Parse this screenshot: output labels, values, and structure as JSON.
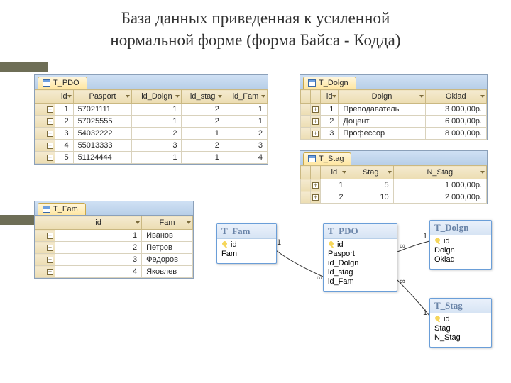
{
  "title_line1": "База данных приведенная к усиленной",
  "title_line2": "нормальной форме  (форма Байса - Кодда)",
  "tables": {
    "pdo": {
      "tab": "T_PDO",
      "cols": [
        "id",
        "Pasport",
        "id_Dolgn",
        "id_stag",
        "id_Fam"
      ],
      "rows": [
        [
          "1",
          "57021111",
          "1",
          "2",
          "1"
        ],
        [
          "2",
          "57025555",
          "1",
          "2",
          "1"
        ],
        [
          "3",
          "54032222",
          "2",
          "1",
          "2"
        ],
        [
          "4",
          "55013333",
          "3",
          "2",
          "3"
        ],
        [
          "5",
          "51124444",
          "1",
          "1",
          "4"
        ]
      ]
    },
    "dolgn": {
      "tab": "T_Dolgn",
      "cols": [
        "id",
        "Dolgn",
        "Oklad"
      ],
      "rows": [
        [
          "1",
          "Преподаватель",
          "3 000,00р."
        ],
        [
          "2",
          "Доцент",
          "6 000,00р."
        ],
        [
          "3",
          "Профессор",
          "8 000,00р."
        ]
      ]
    },
    "stag": {
      "tab": "T_Stag",
      "cols": [
        "id",
        "Stag",
        "N_Stag"
      ],
      "rows": [
        [
          "1",
          "5",
          "1 000,00р."
        ],
        [
          "2",
          "10",
          "2 000,00р."
        ]
      ]
    },
    "fam": {
      "tab": "T_Fam",
      "cols": [
        "id",
        "Fam"
      ],
      "rows": [
        [
          "1",
          "Иванов"
        ],
        [
          "2",
          "Петров"
        ],
        [
          "3",
          "Федоров"
        ],
        [
          "4",
          "Яковлев"
        ]
      ]
    }
  },
  "diagram": {
    "fam": {
      "title": "T_Fam",
      "fields": [
        "id",
        "Fam"
      ]
    },
    "pdo": {
      "title": "T_PDO",
      "fields": [
        "id",
        "Pasport",
        "id_Dolgn",
        "id_stag",
        "id_Fam"
      ]
    },
    "dolgn": {
      "title": "T_Dolgn",
      "fields": [
        "id",
        "Dolgn",
        "Oklad"
      ]
    },
    "stag": {
      "title": "T_Stag",
      "fields": [
        "id",
        "Stag",
        "N_Stag"
      ]
    },
    "card1": "1",
    "cardInf": "∞"
  }
}
